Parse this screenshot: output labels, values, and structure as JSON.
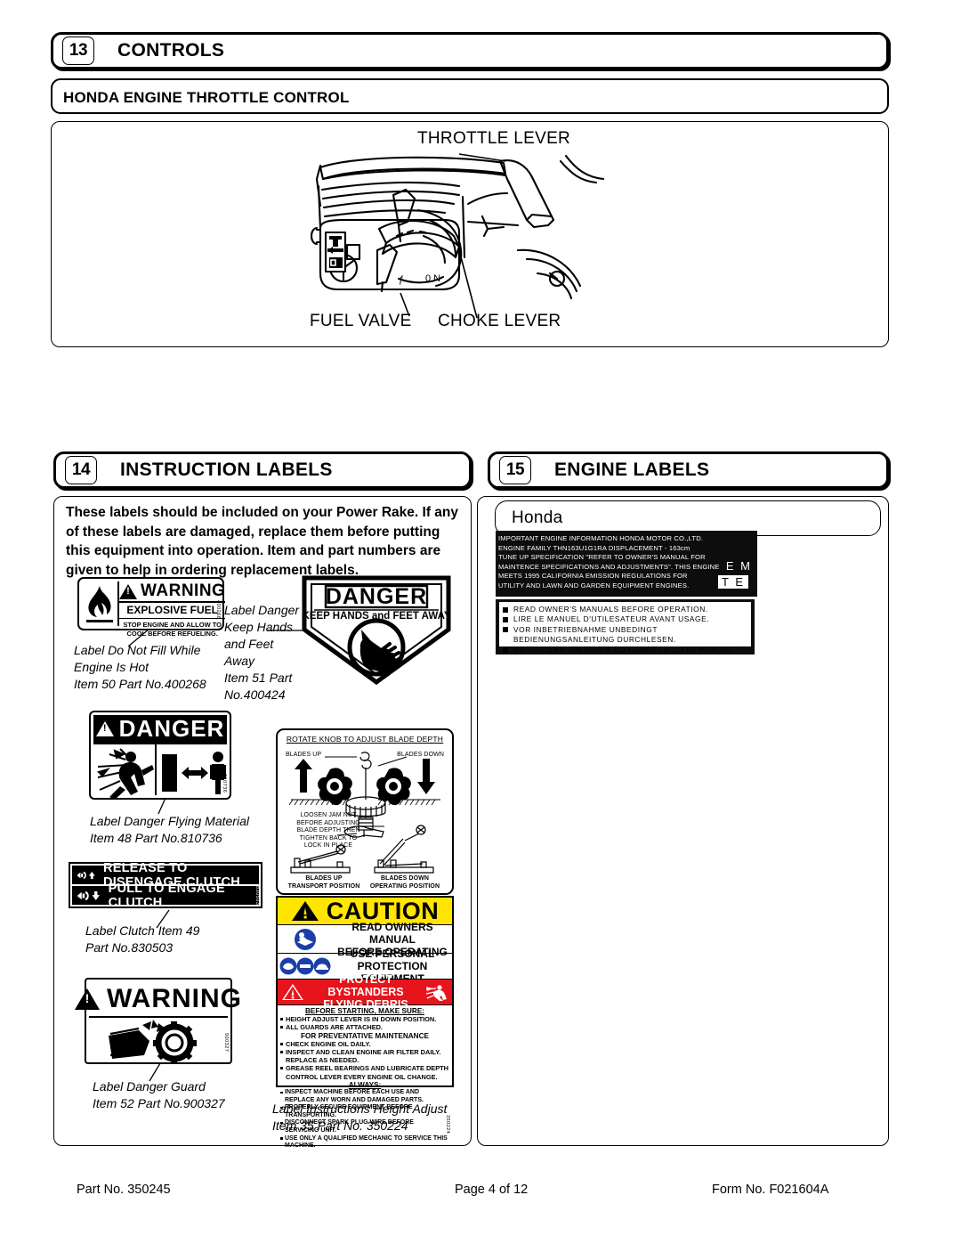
{
  "sections": {
    "controls": {
      "number": "13",
      "title": "CONTROLS",
      "subtitle": "HONDA ENGINE THROTTLE CONTROL"
    },
    "instruction_labels": {
      "number": "14",
      "title": "INSTRUCTION LABELS"
    },
    "engine_labels": {
      "number": "15",
      "title": "ENGINE LABELS"
    }
  },
  "engine_diagram": {
    "callouts": {
      "throttle_lever": "THROTTLE LEVER",
      "fuel_valve": "FUEL VALVE",
      "choke_lever": "CHOKE LEVER"
    }
  },
  "instruction_intro": "These labels should be included on your Power Rake.  If any of these labels are damaged, replace them before putting this equipment into operation. Item and part numbers are given to help in ordering replacement labels.",
  "labels": {
    "explosive_fuel": {
      "signal": "WARNING",
      "headline": "EXPLOSIVE FUEL",
      "body": "STOP ENGINE AND ALLOW TO COOL BEFORE REFUELING.",
      "side_code": "400268",
      "caption": "Label Do Not Fill While\nEngine Is Hot\nItem 50  Part No.400268"
    },
    "keep_hands": {
      "signal": "DANGER",
      "subtext": "KEEP HANDS and FEET AWAY",
      "caption": "Label Danger\nKeep Hands\nand Feet\nAway\nItem 51  Part\nNo.400424"
    },
    "flying_material": {
      "signal": "DANGER",
      "side_code": "810736",
      "caption": "Label Danger Flying Material\nItem 48  Part No.810736"
    },
    "clutch": {
      "line1": "RELEASE TO DISENGAGE CLUTCH",
      "line2": "PULL TO ENGAGE CLUTCH",
      "side_code": "830503",
      "caption": "Label Clutch Item 49\n  Part No.830503"
    },
    "danger_guard": {
      "signal": "WARNING",
      "side_code": "900327",
      "caption": "Label Danger Guard\nItem 52  Part No.900327"
    },
    "height_adjust": {
      "title": "ROTATE KNOB TO ADJUST BLADE DEPTH",
      "blades_up": "BLADES UP",
      "blades_down": "BLADES DOWN",
      "jam_nut_note": "LOOSEN JAM NUT\nBEFORE  ADJUSTING\nBLADE DEPTH THEN\nTIGHTEN BACK TO\nLOCK IN PLACE",
      "pos_left": "BLADES UP\nTRANSPORT POSITION",
      "pos_right": "BLADES DOWN\nOPERATING POSITION",
      "caution": {
        "signal": "CAUTION",
        "row1": "READ OWNERS MANUAL\nBEFORE OPERATING",
        "row2": "USE PERSONAL\nPROTECTION EQUIPMENT",
        "row3": "PROTECT BYSTANDERS\nFLYING DEBRIS",
        "fine": {
          "h1": "BEFORE STARTING, MAKE SURE:",
          "b1": "HEIGHT ADJUST LEVER IS IN DOWN POSITION.",
          "b2": "ALL GUARDS ARE ATTACHED.",
          "h2": "FOR PREVENTATIVE MAINTENANCE",
          "b3": "CHECK ENGINE OIL DAILY.",
          "b4": "INSPECT AND CLEAN ENGINE AIR FILTER DAILY.  REPLACE AS NEEDED.",
          "b5": "GREASE REEL BEARINGS AND LUBRICATE DEPTH CONTROL LEVER EVERY ENGINE OIL CHANGE.",
          "h3": "ALWAYS:",
          "b6": "INSPECT MACHINE BEFORE EACH USE AND REPLACE ANY WORN AND DAMAGED PARTS.",
          "b7": "PROPERLY SECURE EQUIPMENT BEFORE TRANSPORTING.",
          "b8": "DISCONNECT SPARK PLUG WIRE BEFORE SERVICING UNIT.",
          "b9": "USE ONLY A QUALIFIED MECHANIC TO SERVICE THIS MACHINE."
        },
        "side_code": "350224"
      },
      "caption": "Label Instructions Height Adjust\nItem 35  Part No. 350224"
    }
  },
  "engine_labels": {
    "brand": "Honda",
    "emission_plate": {
      "line1": "IMPORTANT ENGINE INFORMATION  HONDA MOTOR CO.,LTD.",
      "line2": "ENGINE FAMILY THN163U1G1RA    DISPLACEMENT - 163cm",
      "line3": "TUNE UP SPECIFICATION \"REFER TO OWNER'S MANUAL FOR",
      "line4": "MAINTENCE SPECIFICATIONS AND ADJUSTMENTS\". THIS ENGINE",
      "line5": "MEETS 1995 CALIFORNIA EMISSION REGULATIONS FOR",
      "line6": "UTILITY AND LAWN AND GARDEN EQUIPMENT ENGINES.",
      "badge_em": "E M",
      "badge_te": "T E"
    },
    "manual_plate": {
      "line1": "READ  OWNER'S  MANUALS  BEFORE  OPERATION.",
      "line2": "LIRE LE MANUEL D'UTILESATEUR AVANT USAGE.",
      "line3": "VOR  INBETRIEBNAHME UNBEDINGT",
      "line4": "BEDIENUNGSANLEITUNG DURCHLESEN.",
      "line5": "NO UTILIZAR SIN ANTES NO HABER LEIDO EL MANUAL."
    }
  },
  "footer": {
    "part_no": "Part No. 350245",
    "page": "Page 4 of 12",
    "form_no": "Form No. F021604A"
  },
  "colors": {
    "caution_yellow": "#FFE500",
    "warning_red": "#E8141C",
    "icon_blue": "#1B3FA8",
    "black": "#000000"
  }
}
